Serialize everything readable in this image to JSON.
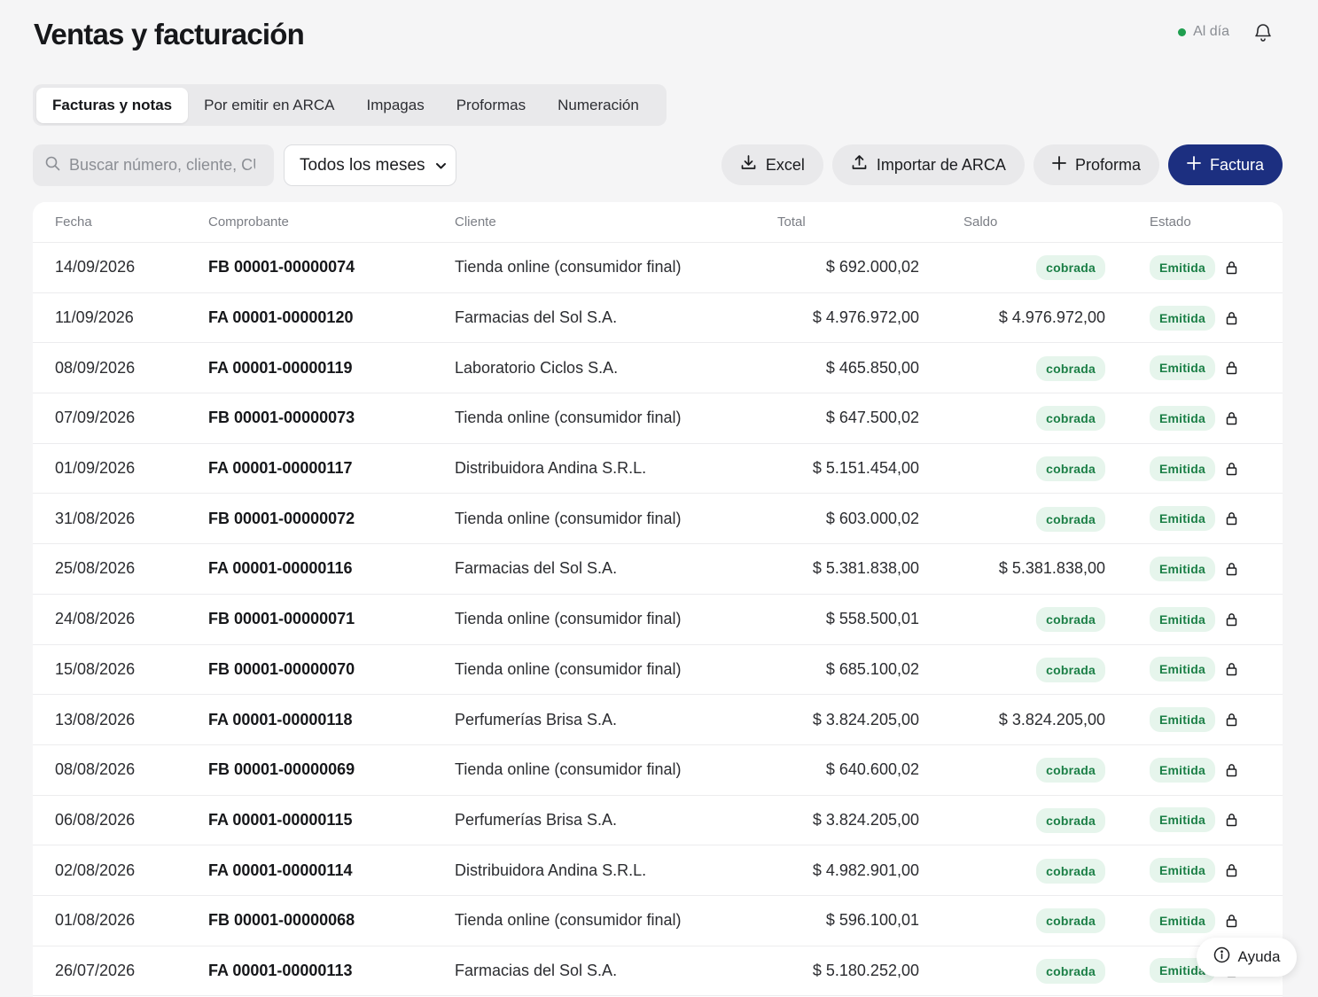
{
  "header": {
    "title": "Ventas y facturación",
    "status": "Al día",
    "status_color": "#1f9e4f",
    "bell_icon": "bell-icon"
  },
  "tabs": [
    {
      "label": "Facturas y notas",
      "active": true
    },
    {
      "label": "Por emitir en ARCA",
      "active": false
    },
    {
      "label": "Impagas",
      "active": false
    },
    {
      "label": "Proformas",
      "active": false
    },
    {
      "label": "Numeración",
      "active": false
    }
  ],
  "toolbar": {
    "search_placeholder": "Buscar número, cliente, CUIT…",
    "month_selected": "Todos los meses",
    "excel_label": "Excel",
    "import_label": "Importar de ARCA",
    "proforma_label": "Proforma",
    "factura_label": "Factura",
    "primary_color": "#1c2f80"
  },
  "table": {
    "columns": [
      "Fecha",
      "Comprobante",
      "Cliente",
      "Total",
      "Saldo",
      "Estado"
    ],
    "rows": [
      {
        "fecha": "14/09/2026",
        "comprobante": "FB 00001-00000074",
        "cliente": "Tienda online (consumidor final)",
        "total": "$ 692.000,02",
        "saldo": "cobrada",
        "estado": "Emitida"
      },
      {
        "fecha": "11/09/2026",
        "comprobante": "FA 00001-00000120",
        "cliente": "Farmacias del Sol S.A.",
        "total": "$ 4.976.972,00",
        "saldo": "$ 4.976.972,00",
        "estado": "Emitida"
      },
      {
        "fecha": "08/09/2026",
        "comprobante": "FA 00001-00000119",
        "cliente": "Laboratorio Ciclos S.A.",
        "total": "$ 465.850,00",
        "saldo": "cobrada",
        "estado": "Emitida"
      },
      {
        "fecha": "07/09/2026",
        "comprobante": "FB 00001-00000073",
        "cliente": "Tienda online (consumidor final)",
        "total": "$ 647.500,02",
        "saldo": "cobrada",
        "estado": "Emitida"
      },
      {
        "fecha": "01/09/2026",
        "comprobante": "FA 00001-00000117",
        "cliente": "Distribuidora Andina S.R.L.",
        "total": "$ 5.151.454,00",
        "saldo": "cobrada",
        "estado": "Emitida"
      },
      {
        "fecha": "31/08/2026",
        "comprobante": "FB 00001-00000072",
        "cliente": "Tienda online (consumidor final)",
        "total": "$ 603.000,02",
        "saldo": "cobrada",
        "estado": "Emitida"
      },
      {
        "fecha": "25/08/2026",
        "comprobante": "FA 00001-00000116",
        "cliente": "Farmacias del Sol S.A.",
        "total": "$ 5.381.838,00",
        "saldo": "$ 5.381.838,00",
        "estado": "Emitida"
      },
      {
        "fecha": "24/08/2026",
        "comprobante": "FB 00001-00000071",
        "cliente": "Tienda online (consumidor final)",
        "total": "$ 558.500,01",
        "saldo": "cobrada",
        "estado": "Emitida"
      },
      {
        "fecha": "15/08/2026",
        "comprobante": "FB 00001-00000070",
        "cliente": "Tienda online (consumidor final)",
        "total": "$ 685.100,02",
        "saldo": "cobrada",
        "estado": "Emitida"
      },
      {
        "fecha": "13/08/2026",
        "comprobante": "FA 00001-00000118",
        "cliente": "Perfumerías Brisa S.A.",
        "total": "$ 3.824.205,00",
        "saldo": "$ 3.824.205,00",
        "estado": "Emitida"
      },
      {
        "fecha": "08/08/2026",
        "comprobante": "FB 00001-00000069",
        "cliente": "Tienda online (consumidor final)",
        "total": "$ 640.600,02",
        "saldo": "cobrada",
        "estado": "Emitida"
      },
      {
        "fecha": "06/08/2026",
        "comprobante": "FA 00001-00000115",
        "cliente": "Perfumerías Brisa S.A.",
        "total": "$ 3.824.205,00",
        "saldo": "cobrada",
        "estado": "Emitida"
      },
      {
        "fecha": "02/08/2026",
        "comprobante": "FA 00001-00000114",
        "cliente": "Distribuidora Andina S.R.L.",
        "total": "$ 4.982.901,00",
        "saldo": "cobrada",
        "estado": "Emitida"
      },
      {
        "fecha": "01/08/2026",
        "comprobante": "FB 00001-00000068",
        "cliente": "Tienda online (consumidor final)",
        "total": "$ 596.100,01",
        "saldo": "cobrada",
        "estado": "Emitida"
      },
      {
        "fecha": "26/07/2026",
        "comprobante": "FA 00001-00000113",
        "cliente": "Farmacias del Sol S.A.",
        "total": "$ 5.180.252,00",
        "saldo": "cobrada",
        "estado": "Emitida"
      }
    ]
  },
  "help": {
    "label": "Ayuda"
  },
  "colors": {
    "badge_bg": "#e6f5ec",
    "badge_text": "#1b7f46"
  }
}
